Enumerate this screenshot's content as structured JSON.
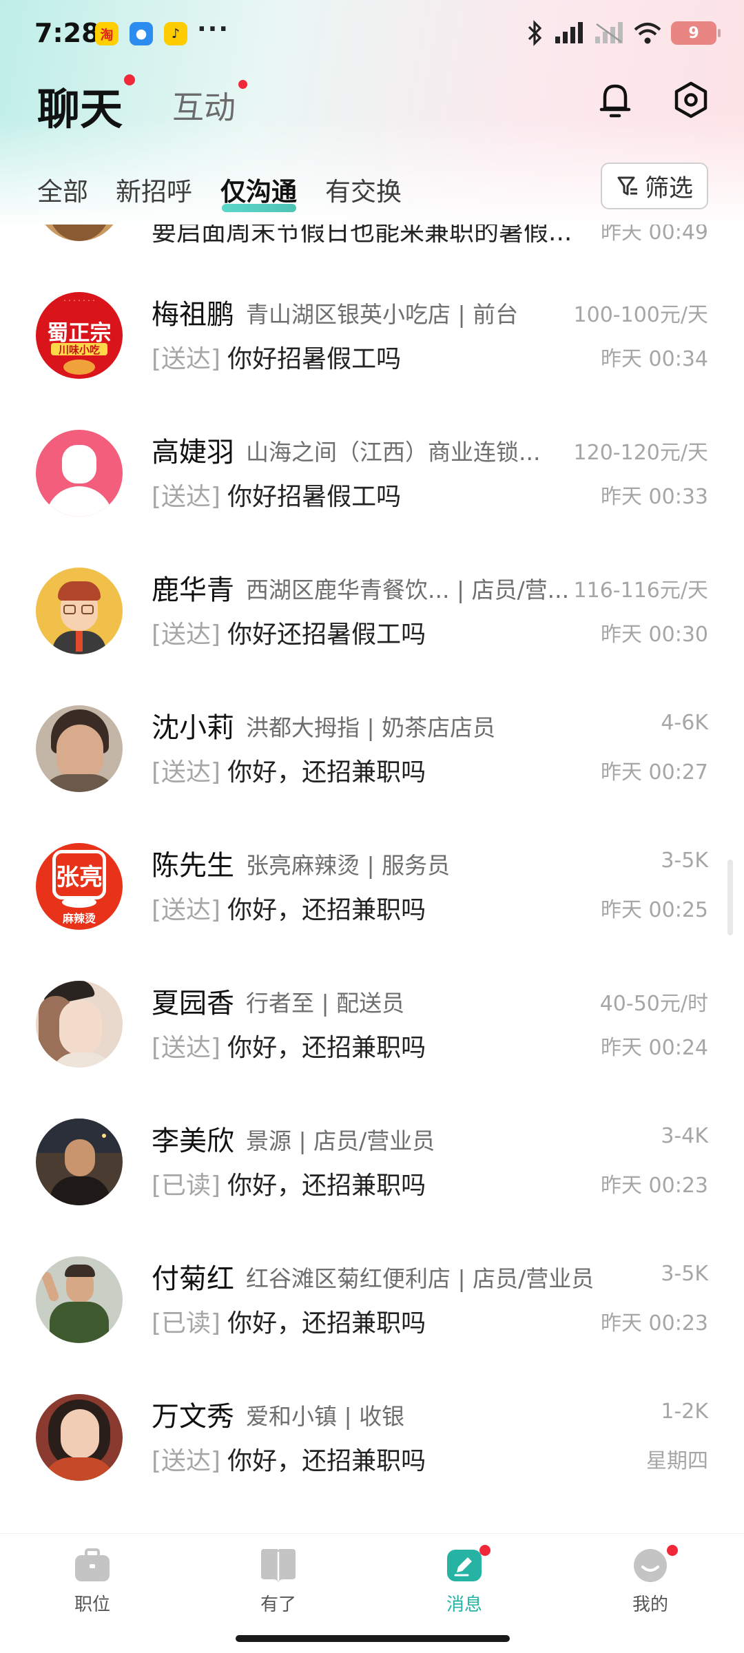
{
  "status_bar": {
    "time": "7:28",
    "app_badges": [
      {
        "text": "淘",
        "bg": "#ffcf00",
        "fg": "#e2231a"
      },
      {
        "text": "●",
        "bg": "#2d8cf0",
        "fg": "#ffffff"
      },
      {
        "text": "♪",
        "bg": "#ffcc00",
        "fg": "#222222"
      }
    ],
    "more": "···",
    "battery": "9"
  },
  "header": {
    "title": "聊天",
    "subtitle": "互动"
  },
  "tabs": [
    {
      "label": "全部",
      "active": false
    },
    {
      "label": "新招呼",
      "active": false
    },
    {
      "label": "仅沟通",
      "active": true
    },
    {
      "label": "有交换",
      "active": false
    }
  ],
  "filter_label": "筛选",
  "conversations": [
    {
      "partial": true,
      "name": "",
      "company": "",
      "salary": "",
      "status": "",
      "message": "要启面周末节假日也能来兼职的暑假...",
      "time": "昨天 00:49",
      "avatar": {
        "type": "photo",
        "bg": "#c99a62"
      }
    },
    {
      "name": "梅祖鹏",
      "company": "青山湖区银英小吃店 | 前台",
      "salary": "100-100元/天",
      "status": "[送达]",
      "message": "你好招暑假工吗",
      "time": "昨天 00:34",
      "avatar": {
        "type": "logo",
        "text": "蜀正宗",
        "sub": "川味小吃",
        "bg": "#d9151b"
      }
    },
    {
      "name": "高婕羽",
      "company": "山海之间（江西）商业连锁...",
      "salary": "120-120元/天",
      "status": "[送达]",
      "message": "你好招暑假工吗",
      "time": "昨天 00:33",
      "avatar": {
        "type": "default",
        "bg": "#f25e7c"
      }
    },
    {
      "name": "鹿华青",
      "company": "西湖区鹿华青餐饮... | 店员/营...",
      "salary": "116-116元/天",
      "status": "[送达]",
      "message": "你好还招暑假工吗",
      "time": "昨天 00:30",
      "avatar": {
        "type": "cartoon",
        "bg": "#f0c04a"
      }
    },
    {
      "name": "沈小莉",
      "company": "洪都大拇指 | 奶茶店店员",
      "salary": "4-6K",
      "status": "[送达]",
      "message": "你好，还招兼职吗",
      "time": "昨天 00:27",
      "avatar": {
        "type": "photo",
        "bg": "#b08a70"
      }
    },
    {
      "name": "陈先生",
      "company": "张亮麻辣烫 | 服务员",
      "salary": "3-5K",
      "status": "[送达]",
      "message": "你好，还招兼职吗",
      "time": "昨天 00:25",
      "avatar": {
        "type": "logo",
        "text": "张亮",
        "sub": "麻辣烫",
        "bg": "#e8321a"
      }
    },
    {
      "name": "夏园香",
      "company": "行者至 | 配送员",
      "salary": "40-50元/时",
      "status": "[送达]",
      "message": "你好，还招兼职吗",
      "time": "昨天 00:24",
      "avatar": {
        "type": "photo",
        "bg": "#d8bfae"
      }
    },
    {
      "name": "李美欣",
      "company": "景源 | 店员/营业员",
      "salary": "3-4K",
      "status": "[已读]",
      "message": "你好，还招兼职吗",
      "time": "昨天 00:23",
      "avatar": {
        "type": "photo",
        "bg": "#5a4a3c"
      }
    },
    {
      "name": "付菊红",
      "company": "红谷滩区菊红便利店 | 店员/营业员",
      "salary": "3-5K",
      "status": "[已读]",
      "message": "你好，还招兼职吗",
      "time": "昨天 00:23",
      "avatar": {
        "type": "photo",
        "bg": "#a9b4a0"
      }
    },
    {
      "name": "万文秀",
      "company": "爱和小镇 | 收银",
      "salary": "1-2K",
      "status": "[送达]",
      "message": "你好，还招兼职吗",
      "time": "星期四",
      "avatar": {
        "type": "photo",
        "bg": "#9a4a3a"
      }
    }
  ],
  "bottom_nav": [
    {
      "label": "职位",
      "active": false,
      "badge": false
    },
    {
      "label": "有了",
      "active": false,
      "badge": false
    },
    {
      "label": "消息",
      "active": true,
      "badge": true
    },
    {
      "label": "我的",
      "active": false,
      "badge": true
    }
  ],
  "colors": {
    "accent": "#26b3a4",
    "badge_red": "#f0283a",
    "muted": "#a6a6a6"
  }
}
